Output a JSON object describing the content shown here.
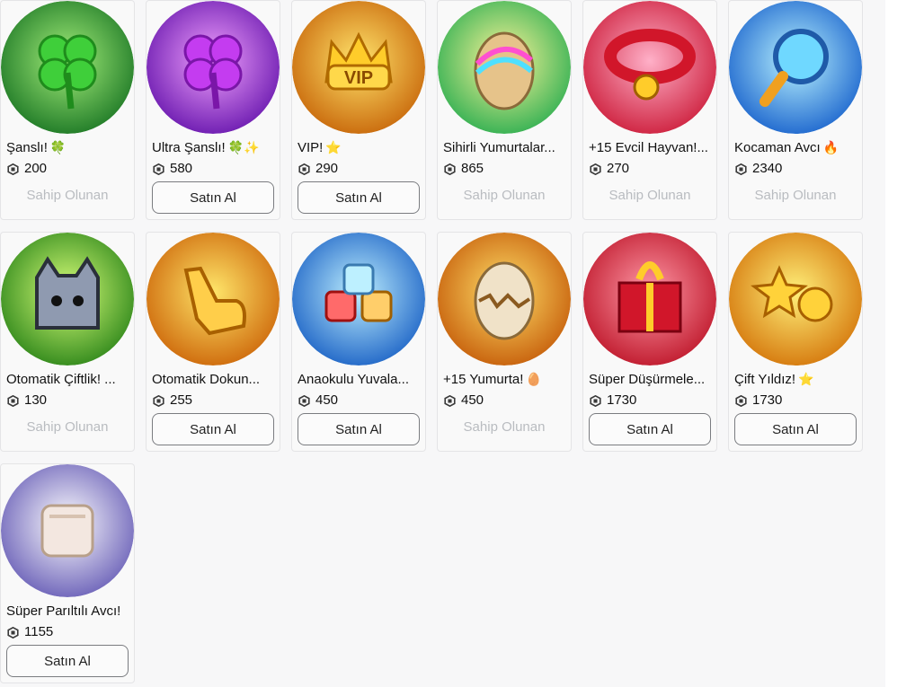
{
  "items": [
    {
      "name": "Şanslı!",
      "emoji": "🍀",
      "price": "200",
      "status": "owned",
      "icon": "clover-icon",
      "bg1": "#a6f07c",
      "bg2": "#0e6b1c"
    },
    {
      "name": "Ultra Şanslı!",
      "emoji": "🍀✨",
      "price": "580",
      "status": "buy",
      "icon": "purple-clover-icon",
      "bg1": "#f3a2ff",
      "bg2": "#5b0aa6"
    },
    {
      "name": "VIP!",
      "emoji": "⭐",
      "price": "290",
      "status": "buy",
      "icon": "vip-crown-icon",
      "bg1": "#ffe36b",
      "bg2": "#c25a00"
    },
    {
      "name": "Sihirli Yumurtalar...",
      "emoji": "",
      "price": "865",
      "status": "owned",
      "icon": "rainbow-egg-icon",
      "bg1": "#fff59a",
      "bg2": "#1aa84a"
    },
    {
      "name": "+15 Evcil Hayvan!...",
      "emoji": "",
      "price": "270",
      "status": "owned",
      "icon": "pet-collar-icon",
      "bg1": "#ffb0c8",
      "bg2": "#c8102e"
    },
    {
      "name": "Kocaman Avcı",
      "emoji": "🔥",
      "price": "2340",
      "status": "owned",
      "icon": "magnifier-icon",
      "bg1": "#b9f3ff",
      "bg2": "#0b56c8"
    },
    {
      "name": "Otomatik Çiftlik! ...",
      "emoji": "",
      "price": "130",
      "status": "owned",
      "icon": "cat-cube-icon",
      "bg1": "#d9ff7a",
      "bg2": "#1c7a10"
    },
    {
      "name": "Otomatik Dokun...",
      "emoji": "",
      "price": "255",
      "status": "buy",
      "icon": "pointing-hand-icon",
      "bg1": "#ffe66a",
      "bg2": "#c85a00"
    },
    {
      "name": "Anaokulu Yuvala...",
      "emoji": "",
      "price": "450",
      "status": "buy",
      "icon": "blocks-icon",
      "bg1": "#bff0ff",
      "bg2": "#0c55c0"
    },
    {
      "name": "+15 Yumurta!",
      "emoji": "🥚",
      "price": "450",
      "status": "owned",
      "icon": "cracked-egg-icon",
      "bg1": "#ffe06a",
      "bg2": "#c05000"
    },
    {
      "name": "Süper Düşürmele...",
      "emoji": "",
      "price": "1730",
      "status": "buy",
      "icon": "gift-box-icon",
      "bg1": "#ff9aa8",
      "bg2": "#b80a1e"
    },
    {
      "name": "Çift Yıldız!",
      "emoji": "⭐",
      "price": "1730",
      "status": "buy",
      "icon": "double-star-icon",
      "bg1": "#fff07a",
      "bg2": "#d06a00"
    },
    {
      "name": "Süper Parıltılı Avcı!",
      "emoji": "",
      "price": "1155",
      "status": "buy",
      "icon": "shiny-cube-icon",
      "bg1": "#ffffff",
      "bg2": "#5a4fb0"
    }
  ],
  "labels": {
    "owned": "Sahip Olunan",
    "buy": "Satın Al"
  },
  "robux_icon": "robux-icon"
}
